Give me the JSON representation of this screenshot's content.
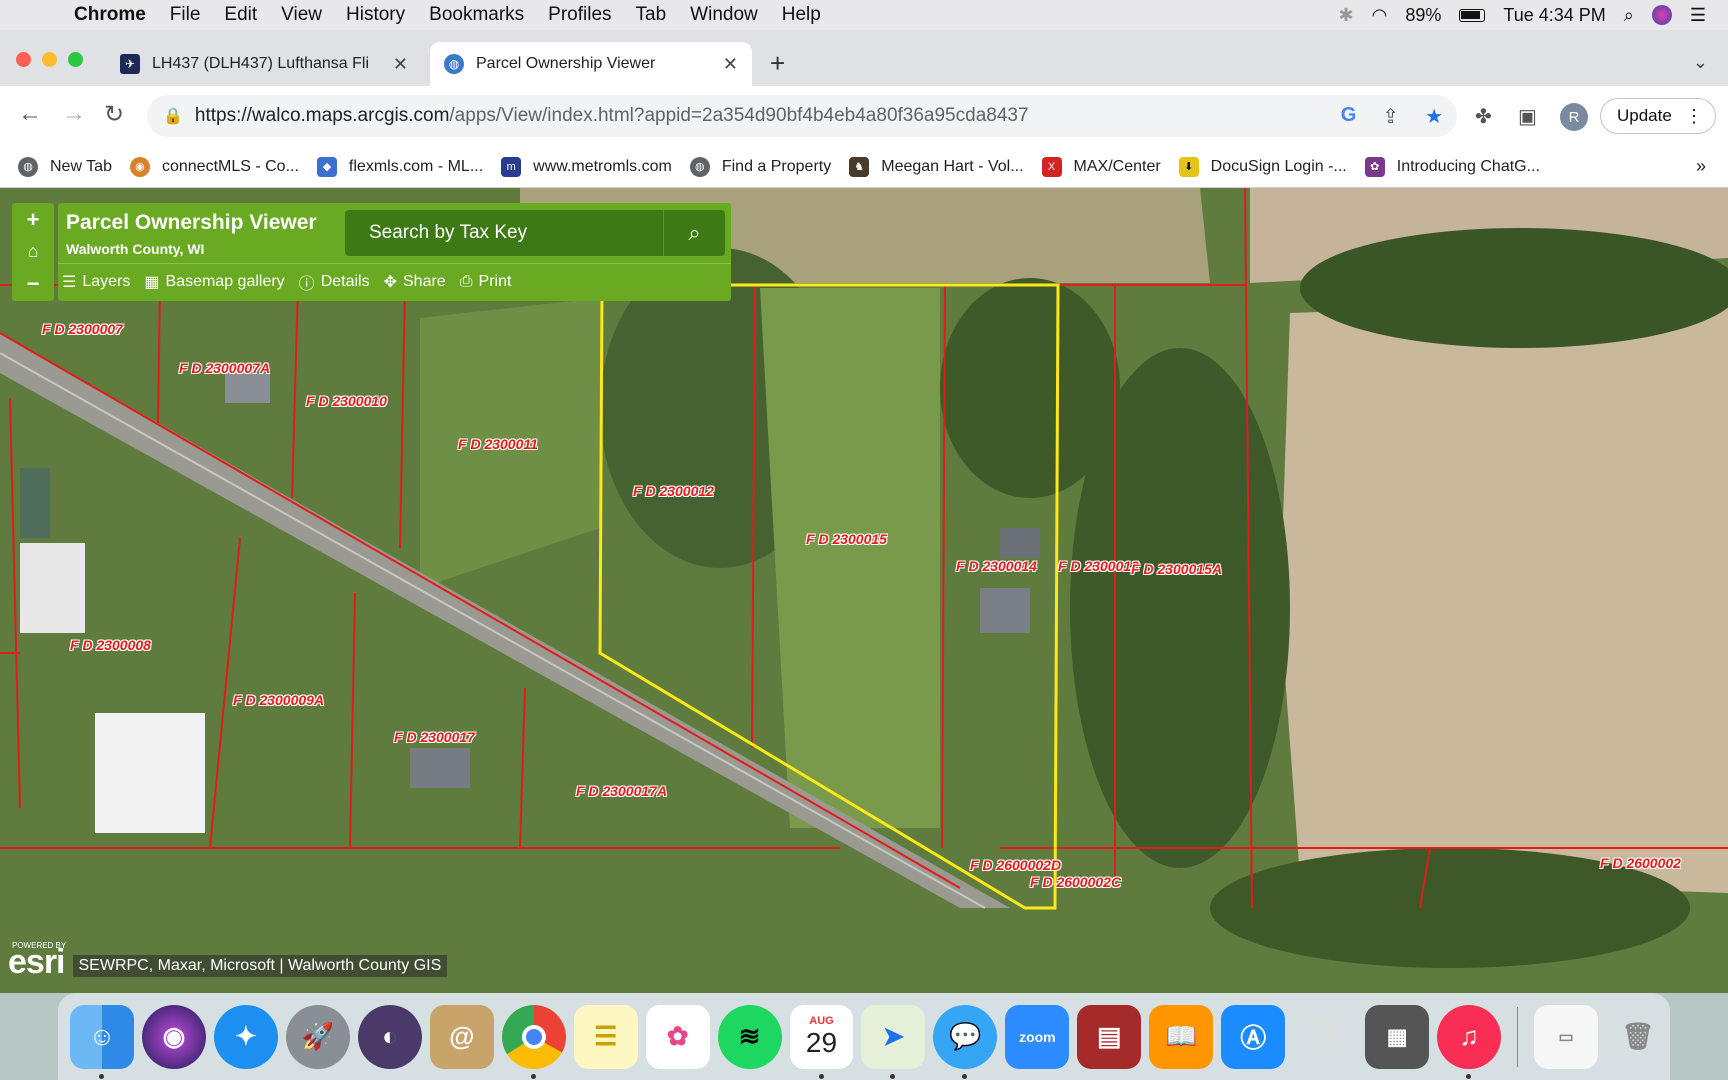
{
  "menubar": {
    "app": "Chrome",
    "items": [
      "File",
      "Edit",
      "View",
      "History",
      "Bookmarks",
      "Profiles",
      "Tab",
      "Window",
      "Help"
    ],
    "battery": "89%",
    "clock": "Tue 4:34 PM"
  },
  "tabs": [
    {
      "title": "LH437 (DLH437) Lufthansa Fli"
    },
    {
      "title": "Parcel Ownership Viewer"
    }
  ],
  "omnibox": {
    "host": "https://walco.maps.arcgis.com",
    "path": "/apps/View/index.html?appid=2a354d90bf4b4eb4a80f36a95cda8437"
  },
  "profile": {
    "initial": "R"
  },
  "update_label": "Update",
  "bookmarks": [
    {
      "label": "New Tab",
      "color": "#5f6368"
    },
    {
      "label": "connectMLS - Co...",
      "color": "#d9822b"
    },
    {
      "label": "flexmls.com - ML...",
      "color": "#3b6fd1"
    },
    {
      "label": "www.metromls.com",
      "color": "#2a3c8f"
    },
    {
      "label": "Find a Property",
      "color": "#5f6368"
    },
    {
      "label": "Meegan Hart - Vol...",
      "color": "#4a3a2a"
    },
    {
      "label": "MAX/Center",
      "color": "#d62222"
    },
    {
      "label": "DocuSign Login -...",
      "color": "#e5c417"
    },
    {
      "label": "Introducing ChatG...",
      "color": "#7a3a8a"
    }
  ],
  "app": {
    "title": "Parcel Ownership Viewer",
    "subtitle": "Walworth County, WI",
    "search_label": "Search by Tax Key",
    "tools": [
      "Layers",
      "Basemap gallery",
      "Details",
      "Share",
      "Print"
    ],
    "attribution": "SEWRPC, Maxar, Microsoft | Walworth County GIS",
    "powered_by": "POWERED BY",
    "esri": "esri"
  },
  "parcels": [
    "F D 2300007",
    "F D 2300007A",
    "F D 2300010",
    "F D 2300011",
    "F D 2300012",
    "F D 2300015",
    "F D 2300014",
    "F D 2300013",
    "F D 2300015A",
    "F D 2300008",
    "F D 2300009A",
    "F D 2300017",
    "F D 2300017A",
    "F D 2600002D",
    "F D 2600002C",
    "F D 2600002"
  ],
  "dock": {
    "calendar_month": "AUG",
    "calendar_day": "29",
    "zoom_label": "zoom"
  }
}
